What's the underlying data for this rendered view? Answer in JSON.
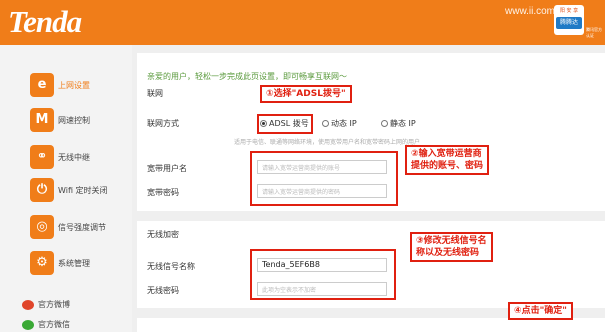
{
  "header": {
    "logo": "Tenda",
    "watermark": "www.ii.com",
    "badge_top": "阳 安 享",
    "badge_main": "腾腾达",
    "badge_side": "腾讯官方认证"
  },
  "sidebar": {
    "items": [
      {
        "label": "上网设置",
        "icon": "e"
      },
      {
        "label": "网速控制",
        "icon": "M"
      },
      {
        "label": "无线中继",
        "icon": "⚭"
      },
      {
        "label": "Wifi 定时关闭",
        "icon": "⏻"
      },
      {
        "label": "信号强度调节",
        "icon": "◎"
      },
      {
        "label": "系统管理",
        "icon": "⚙"
      }
    ],
    "social": [
      {
        "label": "官方微博"
      },
      {
        "label": "官方微信"
      }
    ]
  },
  "main": {
    "intro": "亲爱的用户，轻松一步完成此页设置，即可畅享互联网～",
    "section_network": "联网",
    "conn_label": "联网方式",
    "radios": [
      "ADSL 拨号",
      "动态 IP",
      "静态 IP"
    ],
    "hint": "适用于电信、联通等网络环境，使用宽带用户名和宽带密码上网的用户",
    "user_label": "宽带用户名",
    "user_placeholder": "请输入宽带运营商提供的账号",
    "pass_label": "宽带密码",
    "pass_placeholder": "请输入宽带运营商提供的密码",
    "section_wireless": "无线加密",
    "ssid_label": "无线信号名称",
    "ssid_value": "Tenda_5EF6B8",
    "wpass_label": "无线密码",
    "wpass_placeholder": "此项为空表示不加密"
  },
  "annotations": {
    "step1": "①选择\"ADSL拨号\"",
    "step2_line1": "②输入宽带运营商",
    "step2_line2": "提供的账号、密码",
    "step3_line1": "③修改无线信号名",
    "step3_line2": "称以及无线密码",
    "step4": "④点击\"确定\""
  },
  "colors": {
    "brand": "#f07d19",
    "annotation": "#e02010",
    "intro": "#5a9a3c"
  }
}
